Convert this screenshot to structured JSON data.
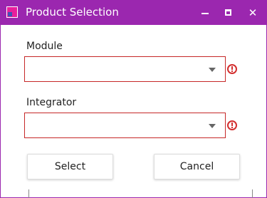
{
  "window": {
    "title": "Product Selection",
    "accent_color": "#9b27af",
    "controls": {
      "minimize_icon": "minimize-icon",
      "maximize_icon": "maximize-icon",
      "close_glyph": "✕"
    }
  },
  "form": {
    "module": {
      "label": "Module",
      "value": "",
      "error_icon": "error-icon",
      "status": "invalid"
    },
    "integrator": {
      "label": "Integrator",
      "value": "",
      "error_icon": "error-icon",
      "status": "invalid"
    },
    "error_color": "#d32f2f"
  },
  "buttons": {
    "select_label": "Select",
    "cancel_label": "Cancel"
  }
}
